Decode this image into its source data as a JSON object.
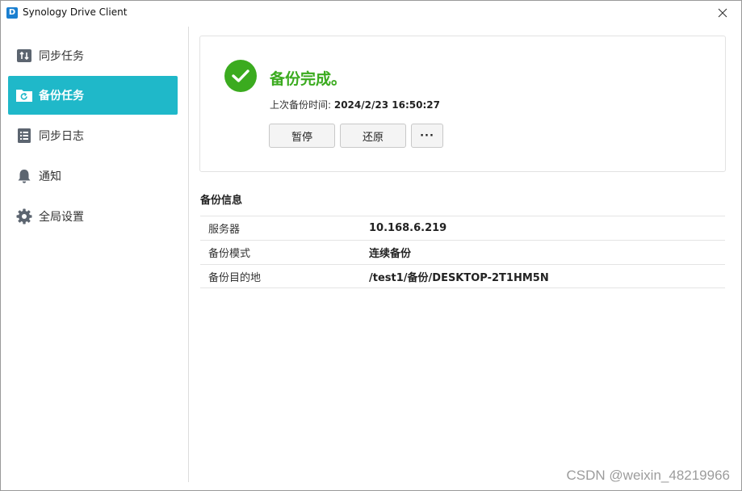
{
  "window": {
    "title": "Synology Drive Client",
    "icon_letter": "D"
  },
  "sidebar": {
    "items": [
      {
        "label": "同步任务",
        "icon": "sync-arrows-icon",
        "active": false
      },
      {
        "label": "备份任务",
        "icon": "backup-folder-icon",
        "active": true
      },
      {
        "label": "同步日志",
        "icon": "log-list-icon",
        "active": false
      },
      {
        "label": "通知",
        "icon": "bell-icon",
        "active": false
      },
      {
        "label": "全局设置",
        "icon": "gear-icon",
        "active": false
      }
    ]
  },
  "status": {
    "title": "备份完成。",
    "last_backup_label": "上次备份时间: ",
    "last_backup_value": "2024/2/23 16:50:27",
    "buttons": {
      "pause": "暂停",
      "restore": "还原",
      "more": "···"
    }
  },
  "info": {
    "title": "备份信息",
    "rows": [
      {
        "key": "服务器",
        "value": "10.168.6.219"
      },
      {
        "key": "备份模式",
        "value": "连续备份"
      },
      {
        "key": "备份目的地",
        "value": "/test1/备份/DESKTOP-2T1HM5N"
      }
    ]
  },
  "watermark": "CSDN @weixin_48219966",
  "colors": {
    "accent": "#1fb8c9",
    "success": "#3bab1f"
  }
}
